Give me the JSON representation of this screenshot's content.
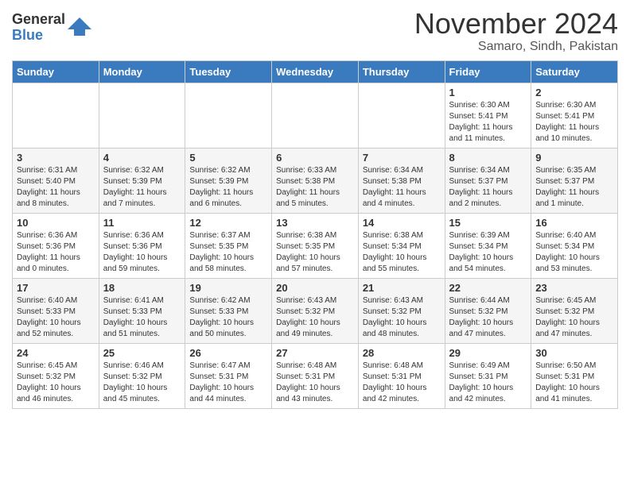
{
  "logo": {
    "general": "General",
    "blue": "Blue"
  },
  "title": "November 2024",
  "location": "Samaro, Sindh, Pakistan",
  "days_of_week": [
    "Sunday",
    "Monday",
    "Tuesday",
    "Wednesday",
    "Thursday",
    "Friday",
    "Saturday"
  ],
  "weeks": [
    [
      {
        "day": "",
        "info": ""
      },
      {
        "day": "",
        "info": ""
      },
      {
        "day": "",
        "info": ""
      },
      {
        "day": "",
        "info": ""
      },
      {
        "day": "",
        "info": ""
      },
      {
        "day": "1",
        "info": "Sunrise: 6:30 AM\nSunset: 5:41 PM\nDaylight: 11 hours and 11 minutes."
      },
      {
        "day": "2",
        "info": "Sunrise: 6:30 AM\nSunset: 5:41 PM\nDaylight: 11 hours and 10 minutes."
      }
    ],
    [
      {
        "day": "3",
        "info": "Sunrise: 6:31 AM\nSunset: 5:40 PM\nDaylight: 11 hours and 8 minutes."
      },
      {
        "day": "4",
        "info": "Sunrise: 6:32 AM\nSunset: 5:39 PM\nDaylight: 11 hours and 7 minutes."
      },
      {
        "day": "5",
        "info": "Sunrise: 6:32 AM\nSunset: 5:39 PM\nDaylight: 11 hours and 6 minutes."
      },
      {
        "day": "6",
        "info": "Sunrise: 6:33 AM\nSunset: 5:38 PM\nDaylight: 11 hours and 5 minutes."
      },
      {
        "day": "7",
        "info": "Sunrise: 6:34 AM\nSunset: 5:38 PM\nDaylight: 11 hours and 4 minutes."
      },
      {
        "day": "8",
        "info": "Sunrise: 6:34 AM\nSunset: 5:37 PM\nDaylight: 11 hours and 2 minutes."
      },
      {
        "day": "9",
        "info": "Sunrise: 6:35 AM\nSunset: 5:37 PM\nDaylight: 11 hours and 1 minute."
      }
    ],
    [
      {
        "day": "10",
        "info": "Sunrise: 6:36 AM\nSunset: 5:36 PM\nDaylight: 11 hours and 0 minutes."
      },
      {
        "day": "11",
        "info": "Sunrise: 6:36 AM\nSunset: 5:36 PM\nDaylight: 10 hours and 59 minutes."
      },
      {
        "day": "12",
        "info": "Sunrise: 6:37 AM\nSunset: 5:35 PM\nDaylight: 10 hours and 58 minutes."
      },
      {
        "day": "13",
        "info": "Sunrise: 6:38 AM\nSunset: 5:35 PM\nDaylight: 10 hours and 57 minutes."
      },
      {
        "day": "14",
        "info": "Sunrise: 6:38 AM\nSunset: 5:34 PM\nDaylight: 10 hours and 55 minutes."
      },
      {
        "day": "15",
        "info": "Sunrise: 6:39 AM\nSunset: 5:34 PM\nDaylight: 10 hours and 54 minutes."
      },
      {
        "day": "16",
        "info": "Sunrise: 6:40 AM\nSunset: 5:34 PM\nDaylight: 10 hours and 53 minutes."
      }
    ],
    [
      {
        "day": "17",
        "info": "Sunrise: 6:40 AM\nSunset: 5:33 PM\nDaylight: 10 hours and 52 minutes."
      },
      {
        "day": "18",
        "info": "Sunrise: 6:41 AM\nSunset: 5:33 PM\nDaylight: 10 hours and 51 minutes."
      },
      {
        "day": "19",
        "info": "Sunrise: 6:42 AM\nSunset: 5:33 PM\nDaylight: 10 hours and 50 minutes."
      },
      {
        "day": "20",
        "info": "Sunrise: 6:43 AM\nSunset: 5:32 PM\nDaylight: 10 hours and 49 minutes."
      },
      {
        "day": "21",
        "info": "Sunrise: 6:43 AM\nSunset: 5:32 PM\nDaylight: 10 hours and 48 minutes."
      },
      {
        "day": "22",
        "info": "Sunrise: 6:44 AM\nSunset: 5:32 PM\nDaylight: 10 hours and 47 minutes."
      },
      {
        "day": "23",
        "info": "Sunrise: 6:45 AM\nSunset: 5:32 PM\nDaylight: 10 hours and 47 minutes."
      }
    ],
    [
      {
        "day": "24",
        "info": "Sunrise: 6:45 AM\nSunset: 5:32 PM\nDaylight: 10 hours and 46 minutes."
      },
      {
        "day": "25",
        "info": "Sunrise: 6:46 AM\nSunset: 5:32 PM\nDaylight: 10 hours and 45 minutes."
      },
      {
        "day": "26",
        "info": "Sunrise: 6:47 AM\nSunset: 5:31 PM\nDaylight: 10 hours and 44 minutes."
      },
      {
        "day": "27",
        "info": "Sunrise: 6:48 AM\nSunset: 5:31 PM\nDaylight: 10 hours and 43 minutes."
      },
      {
        "day": "28",
        "info": "Sunrise: 6:48 AM\nSunset: 5:31 PM\nDaylight: 10 hours and 42 minutes."
      },
      {
        "day": "29",
        "info": "Sunrise: 6:49 AM\nSunset: 5:31 PM\nDaylight: 10 hours and 42 minutes."
      },
      {
        "day": "30",
        "info": "Sunrise: 6:50 AM\nSunset: 5:31 PM\nDaylight: 10 hours and 41 minutes."
      }
    ]
  ]
}
